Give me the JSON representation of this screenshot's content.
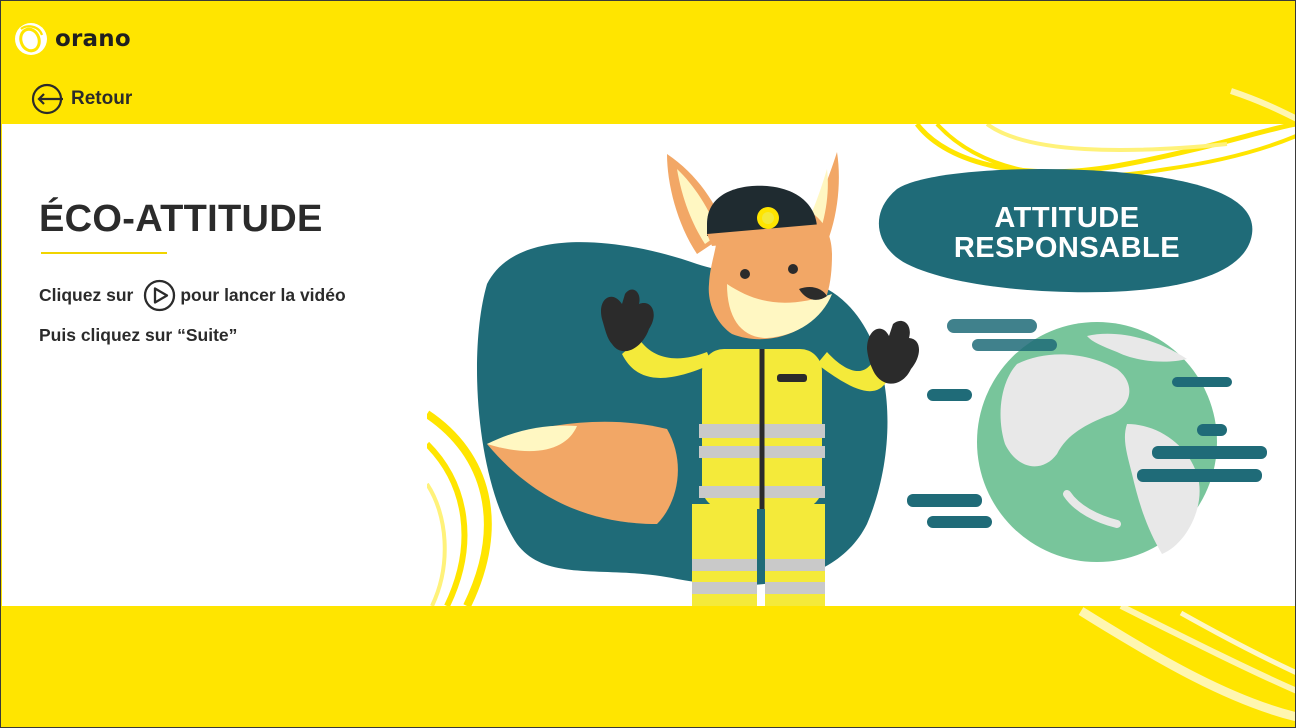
{
  "header": {
    "brand": "orano",
    "back_label": "Retour"
  },
  "main": {
    "title": "ÉCO-ATTITUDE",
    "instruction_line1_before": "Cliquez sur",
    "instruction_line1_after": "pour lancer la vidéo",
    "instruction_line2": "Puis cliquez sur “Suite”"
  },
  "video": {
    "badge_line1": "ATTITUDE",
    "badge_line2": "RESPONSABLE"
  },
  "icons": {
    "logo": "orano-logo-icon",
    "back": "arrow-left-circle-icon",
    "play": "play-circle-icon"
  },
  "colors": {
    "brand_yellow": "#ffe500",
    "dark_teal": "#1f6b78",
    "fox_orange": "#f2a766",
    "suit_yellow": "#f4ea3a",
    "globe_green": "#78c59b",
    "text_dark": "#2b2b2b"
  }
}
